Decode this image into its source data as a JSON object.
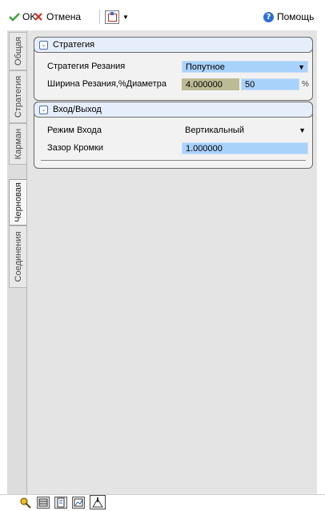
{
  "toolbar": {
    "ok_label": "OK",
    "cancel_label": "Отмена",
    "help_label": "Помощь"
  },
  "tabs": [
    {
      "label": "Общая"
    },
    {
      "label": "Стратегия"
    },
    {
      "label": "Карман"
    },
    {
      "label": "Черновая"
    },
    {
      "label": "Соединения"
    }
  ],
  "active_tab": "Черновая",
  "strategy_group": {
    "title": "Стратегия",
    "cutting_strategy_label": "Стратегия Резания",
    "cutting_strategy_value": "Попутное",
    "cut_width_label": "Ширина Резания,%Диаметра",
    "cut_width_value": "4.000000",
    "cut_width_percent": "50",
    "cut_width_unit": "%"
  },
  "io_group": {
    "title": "Вход/Выход",
    "entry_mode_label": "Режим Входа",
    "entry_mode_value": "Вертикальный",
    "edge_clearance_label": "Зазор Кромки",
    "edge_clearance_value": "1.000000"
  },
  "colors": {
    "field_blue": "#a9d2fb",
    "field_olive": "#bcbb96",
    "header_blue": "#e6eefb"
  }
}
